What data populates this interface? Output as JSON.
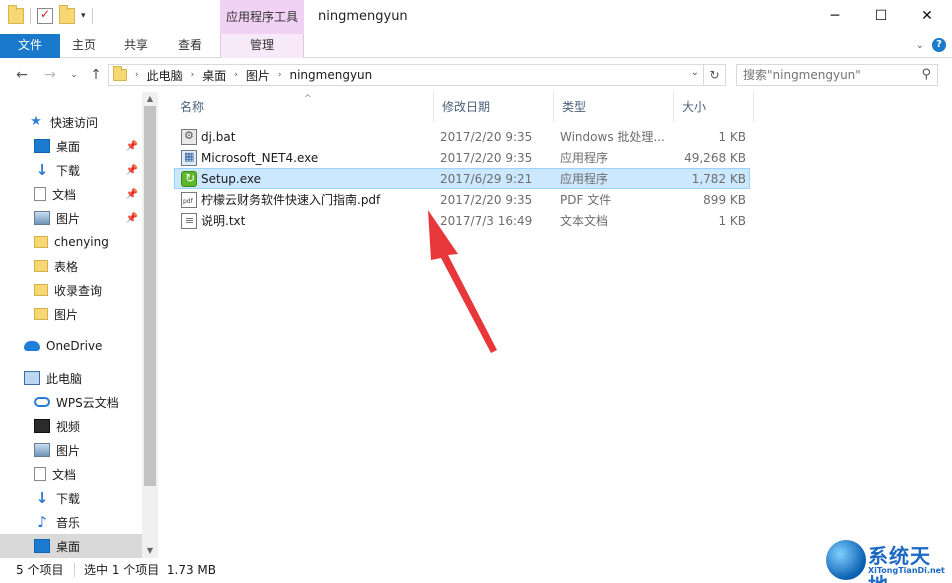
{
  "window": {
    "title": "ningmengyun",
    "context_tab_group": "应用程序工具",
    "minimize": "─",
    "maximize": "☐",
    "close": "✕"
  },
  "ribbon": {
    "tabs": [
      "文件",
      "主页",
      "共享",
      "查看",
      "管理"
    ]
  },
  "address": {
    "crumbs": [
      "此电脑",
      "桌面",
      "图片",
      "ningmengyun"
    ],
    "search_placeholder": "搜索\"ningmengyun\""
  },
  "nav": {
    "items": [
      {
        "label": "快速访问",
        "icon": "star-icon",
        "pinned": false
      },
      {
        "label": "桌面",
        "icon": "desktop-icon",
        "pinned": true
      },
      {
        "label": "下载",
        "icon": "download-icon",
        "pinned": true
      },
      {
        "label": "文档",
        "icon": "document-icon",
        "pinned": true
      },
      {
        "label": "图片",
        "icon": "pictures-icon",
        "pinned": true
      },
      {
        "label": "chenying",
        "icon": "folder-icon",
        "pinned": false
      },
      {
        "label": "表格",
        "icon": "folder-icon",
        "pinned": false
      },
      {
        "label": "收录查询",
        "icon": "folder-icon",
        "pinned": false
      },
      {
        "label": "图片",
        "icon": "folder-icon",
        "pinned": false
      },
      {
        "label": "OneDrive",
        "icon": "onedrive-icon",
        "pinned": false
      },
      {
        "label": "此电脑",
        "icon": "this-pc-icon",
        "pinned": false
      },
      {
        "label": "WPS云文档",
        "icon": "wps-cloud-icon",
        "pinned": false
      },
      {
        "label": "视频",
        "icon": "video-icon",
        "pinned": false
      },
      {
        "label": "图片",
        "icon": "pictures-icon",
        "pinned": false
      },
      {
        "label": "文档",
        "icon": "document-icon",
        "pinned": false
      },
      {
        "label": "下载",
        "icon": "download-icon",
        "pinned": false
      },
      {
        "label": "音乐",
        "icon": "music-icon",
        "pinned": false
      },
      {
        "label": "桌面",
        "icon": "desktop-icon",
        "pinned": false
      }
    ]
  },
  "columns": {
    "name": "名称",
    "date": "修改日期",
    "type": "类型",
    "size": "大小"
  },
  "files": [
    {
      "name": "dj.bat",
      "date": "2017/2/20 9:35",
      "type": "Windows 批处理...",
      "size": "1 KB",
      "icon": "batch-file-icon"
    },
    {
      "name": "Microsoft_NET4.exe",
      "date": "2017/2/20 9:35",
      "type": "应用程序",
      "size": "49,268 KB",
      "icon": "exe-file-icon"
    },
    {
      "name": "Setup.exe",
      "date": "2017/6/29 9:21",
      "type": "应用程序",
      "size": "1,782 KB",
      "icon": "setup-exe-icon",
      "selected": true
    },
    {
      "name": "柠檬云财务软件快速入门指南.pdf",
      "date": "2017/2/20 9:35",
      "type": "PDF 文件",
      "size": "899 KB",
      "icon": "pdf-file-icon"
    },
    {
      "name": "说明.txt",
      "date": "2017/7/3 16:49",
      "type": "文本文档",
      "size": "1 KB",
      "icon": "text-file-icon"
    }
  ],
  "status": {
    "item_count": "5 个项目",
    "selection": "选中 1 个项目  1.73 MB"
  },
  "watermark": {
    "text": "系统天地",
    "sub": "XiTongTianDi.net"
  },
  "colors": {
    "accent": "#1979ca",
    "selected_row": "#cce8ff",
    "arrow": "#e8373b"
  }
}
